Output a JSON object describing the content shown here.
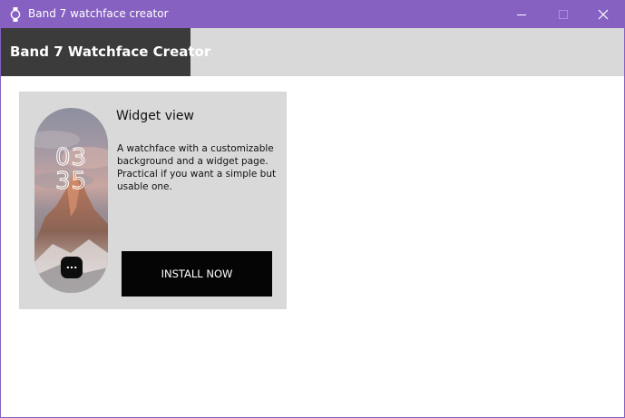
{
  "window": {
    "title": "Band 7 watchface creator",
    "icon": "watch-icon",
    "accent_color": "#8661c1"
  },
  "header": {
    "tab_label": "Band 7 Watchface Creator"
  },
  "card": {
    "title": "Widget view",
    "description": "A watchface with a customizable background and a widget page. Practical if you want a simple but usable one.",
    "install_label": "INSTALL NOW",
    "preview": {
      "hours": "03",
      "minutes": "35",
      "widget_button_label": "..."
    }
  }
}
